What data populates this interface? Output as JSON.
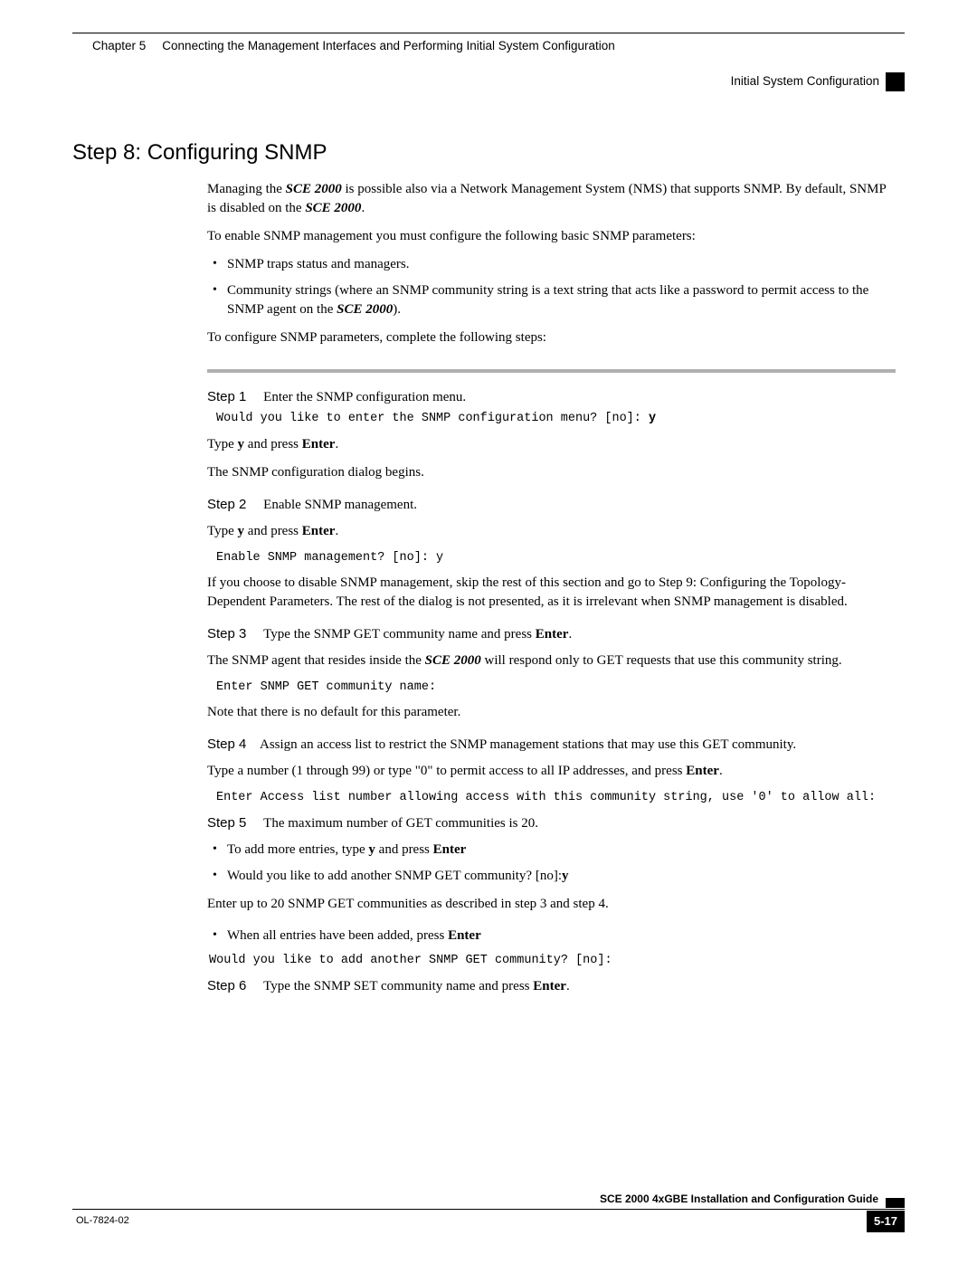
{
  "header": {
    "chapter_label": "Chapter 5",
    "chapter_title": "Connecting the Management Interfaces and Performing Initial System Configuration",
    "section_label": "Initial System Configuration"
  },
  "heading": "Step 8: Configuring SNMP",
  "intro": {
    "p1_a": "Managing the ",
    "p1_b": "SCE 2000",
    "p1_c": " is possible also via a Network Management System (NMS) that supports SNMP. By default, SNMP is disabled on the ",
    "p1_d": "SCE 2000",
    "p1_e": ".",
    "p2": "To enable SNMP management you must configure the following basic SNMP parameters:",
    "bullets": {
      "b1": "SNMP traps status and managers.",
      "b2_a": "Community strings (where an SNMP community string is a text string that acts like a password to permit access to the SNMP agent on the ",
      "b2_b": "SCE 2000",
      "b2_c": ")."
    },
    "p3": "To configure SNMP parameters, complete the following steps:"
  },
  "steps": {
    "s1": {
      "label": "Step 1",
      "title": "Enter the SNMP configuration menu.",
      "code_a": "Would you like to enter the SNMP configuration menu? [no]: ",
      "code_b": "y",
      "p1_a": "Type ",
      "p1_b": "y",
      "p1_c": " and press ",
      "p1_d": "Enter",
      "p1_e": ".",
      "p2": "The SNMP configuration dialog begins."
    },
    "s2": {
      "label": "Step 2",
      "title": "Enable SNMP management.",
      "p1_a": "Type ",
      "p1_b": "y",
      "p1_c": " and press ",
      "p1_d": "Enter",
      "p1_e": ".",
      "code": "Enable SNMP management? [no]: y",
      "p2": "If you choose to disable SNMP management, skip the rest of this section and go to Step 9: Configuring the Topology-Dependent Parameters. The rest of the dialog is not presented, as it is irrelevant when SNMP management is disabled."
    },
    "s3": {
      "label": "Step 3",
      "title_a": "Type the SNMP GET community name and press ",
      "title_b": "Enter",
      "title_c": ".",
      "p1_a": "The SNMP agent that resides inside the ",
      "p1_b": "SCE 2000",
      "p1_c": " will respond only to GET requests that use this community string.",
      "code": "Enter SNMP GET community name:",
      "p2": "Note that there is no default for this parameter."
    },
    "s4": {
      "label": "Step 4",
      "title": "Assign an access list to restrict the SNMP management stations that may use this GET community.",
      "p1_a": "Type a number (1 through 99) or type \"0\" to permit access to all IP addresses, and press ",
      "p1_b": "Enter",
      "p1_c": ".",
      "code": "Enter Access list number allowing access with this community string, use '0' to allow all:"
    },
    "s5": {
      "label": "Step 5",
      "title": "The maximum number of GET communities is 20.",
      "b1_a": "To add more entries, type ",
      "b1_b": "y",
      "b1_c": " and press ",
      "b1_d": "Enter",
      "b2_a": "Would you like to add another SNMP GET community? [no]:",
      "b2_b": "y",
      "p1": "Enter up to 20 SNMP GET communities as described in step 3 and step 4.",
      "b3_a": "When all entries have been added, press ",
      "b3_b": "Enter",
      "code": "Would you like to add another SNMP GET community? [no]:"
    },
    "s6": {
      "label": "Step 6",
      "title_a": "Type the SNMP SET community name and press ",
      "title_b": "Enter",
      "title_c": "."
    }
  },
  "footer": {
    "guide": "SCE 2000 4xGBE Installation and Configuration Guide",
    "docnum": "OL-7824-02",
    "page": "5-17"
  }
}
